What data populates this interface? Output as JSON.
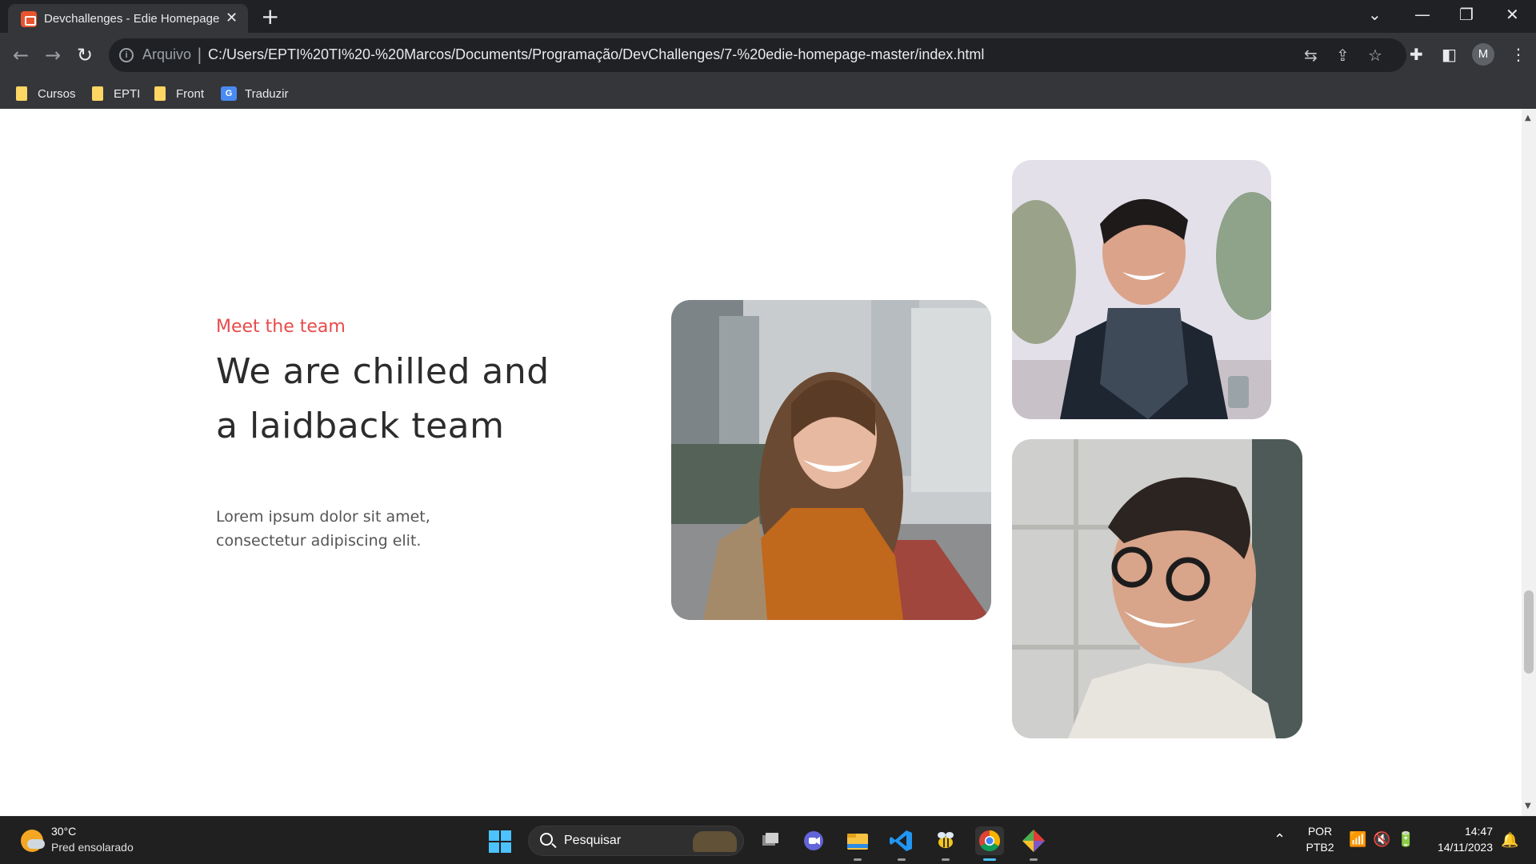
{
  "browser": {
    "tab_title": "Devchallenges - Edie Homepage",
    "address_scheme": "Arquivo",
    "address_url": "C:/Users/EPTI%20TI%20-%20Marcos/Documents/Programação/DevChallenges/7-%20edie-homepage-master/index.html",
    "profile_initial": "M",
    "bookmarks": [
      "Cursos",
      "EPTI",
      "Front",
      "Traduzir"
    ]
  },
  "page": {
    "eyebrow": "Meet the team",
    "heading": "We are chilled and a laidback team",
    "body": "Lorem ipsum dolor sit amet, consectetur adipiscing elit.",
    "accent_color": "#e84b4b",
    "heading_color": "#2c2c2c"
  },
  "taskbar": {
    "weather_temp": "30°C",
    "weather_desc": "Pred ensolarado",
    "search_placeholder": "Pesquisar",
    "lang_primary": "POR",
    "lang_secondary": "PTB2",
    "time": "14:47",
    "date": "14/11/2023",
    "apps": [
      "task-view",
      "teams-chat",
      "file-explorer",
      "vscode",
      "bee-app",
      "chrome",
      "git-app"
    ]
  }
}
